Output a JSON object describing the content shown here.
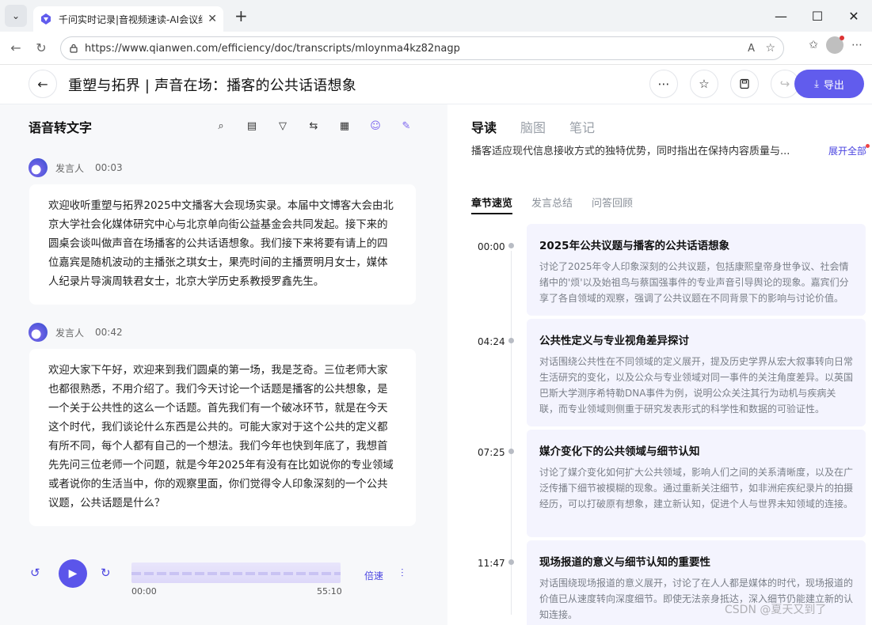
{
  "browser": {
    "tab_title": "千问实时记录|音视频速读-AI会议纪",
    "url": "https://www.qianwen.com/efficiency/doc/transcripts/mloynma4kz82nagp"
  },
  "header": {
    "title": "重塑与拓界 | 声音在场：播客的公共话语想象",
    "export_label": "导出"
  },
  "left": {
    "title": "语音转文字",
    "segments": [
      {
        "speaker": "发言人",
        "time": "00:03",
        "text": "欢迎收听重塑与拓界2025中文播客大会现场实录。本届中文博客大会由北京大学社会化媒体研究中心与北京单向街公益基金会共同发起。接下来的圆桌会谈叫做声音在场播客的公共话语想象。我们接下来将要有请上的四位嘉宾是随机波动的主播张之琪女士，果壳时间的主播贾明月女士，媒体人纪录片导演周轶君女士，北京大学历史系教授罗鑫先生。"
      },
      {
        "speaker": "发言人",
        "time": "00:42",
        "text": "欢迎大家下午好，欢迎来到我们圆桌的第一场，我是芝奇。三位老师大家也都很熟悉，不用介绍了。我们今天讨论一个话题是播客的公共想象，是一个关于公共性的这么一个话题。首先我们有一个破冰环节，就是在今天这个时代，我们谈论什么东西是公共的。可能大家对于这个公共的定义都有所不同，每个人都有自己的一个想法。我们今年也快到年底了，我想首先先问三位老师一个问题，就是今年2025年有没有在比如说你的专业领域或者说你的生活当中，你的观察里面，你们觉得令人印象深刻的一个公共议题，公共话题是什么？"
      }
    ],
    "player": {
      "time_start": "00:00",
      "time_end": "55:10",
      "speed_label": "倍速",
      "progress": 0
    }
  },
  "right": {
    "tabs": [
      "导读",
      "脑图",
      "笔记"
    ],
    "summary": "播客适应现代信息接收方式的独特优势，同时指出在保持内容质量与...",
    "expand_label": "展开全部",
    "subtabs": [
      "章节速览",
      "发言总结",
      "问答回顾"
    ],
    "chapters": [
      {
        "time": "00:00",
        "title": "2025年公共议题与播客的公共话语想象",
        "body": "讨论了2025年令人印象深刻的公共议题，包括康熙皇帝身世争议、社会情绪中的'烦'以及始祖鸟与蔡国强事件的专业声音引导舆论的现象。嘉宾们分享了各自领域的观察，强调了公共议题在不同背景下的影响与讨论价值。"
      },
      {
        "time": "04:24",
        "title": "公共性定义与专业视角差异探讨",
        "body": "对话围绕公共性在不同领域的定义展开，提及历史学界从宏大叙事转向日常生活研究的变化，以及公众与专业领域对同一事件的关注角度差异。以英国巴斯大学测序希特勒DNA事件为例，说明公众关注其行为动机与疾病关联，而专业领域则侧重于研究发表形式的科学性和数据的可验证性。"
      },
      {
        "time": "07:25",
        "title": "媒介变化下的公共领域与细节认知",
        "body": "讨论了媒介变化如何扩大公共领域，影响人们之间的关系清晰度，以及在广泛传播下细节被模糊的现象。通过重新关注细节，如非洲疟疾纪录片的拍摄经历，可以打破原有想象，建立新认知，促进个人与世界未知领域的连接。"
      },
      {
        "time": "11:47",
        "title": "现场报道的意义与细节认知的重要性",
        "body": "对话围绕现场报道的意义展开，讨论了在人人都是媒体的时代，现场报道的价值已从速度转向深度细节。即使无法亲身抵达，深入细节仍能建立新的认知连接。"
      }
    ]
  },
  "watermark": "CSDN @夏天又到了"
}
